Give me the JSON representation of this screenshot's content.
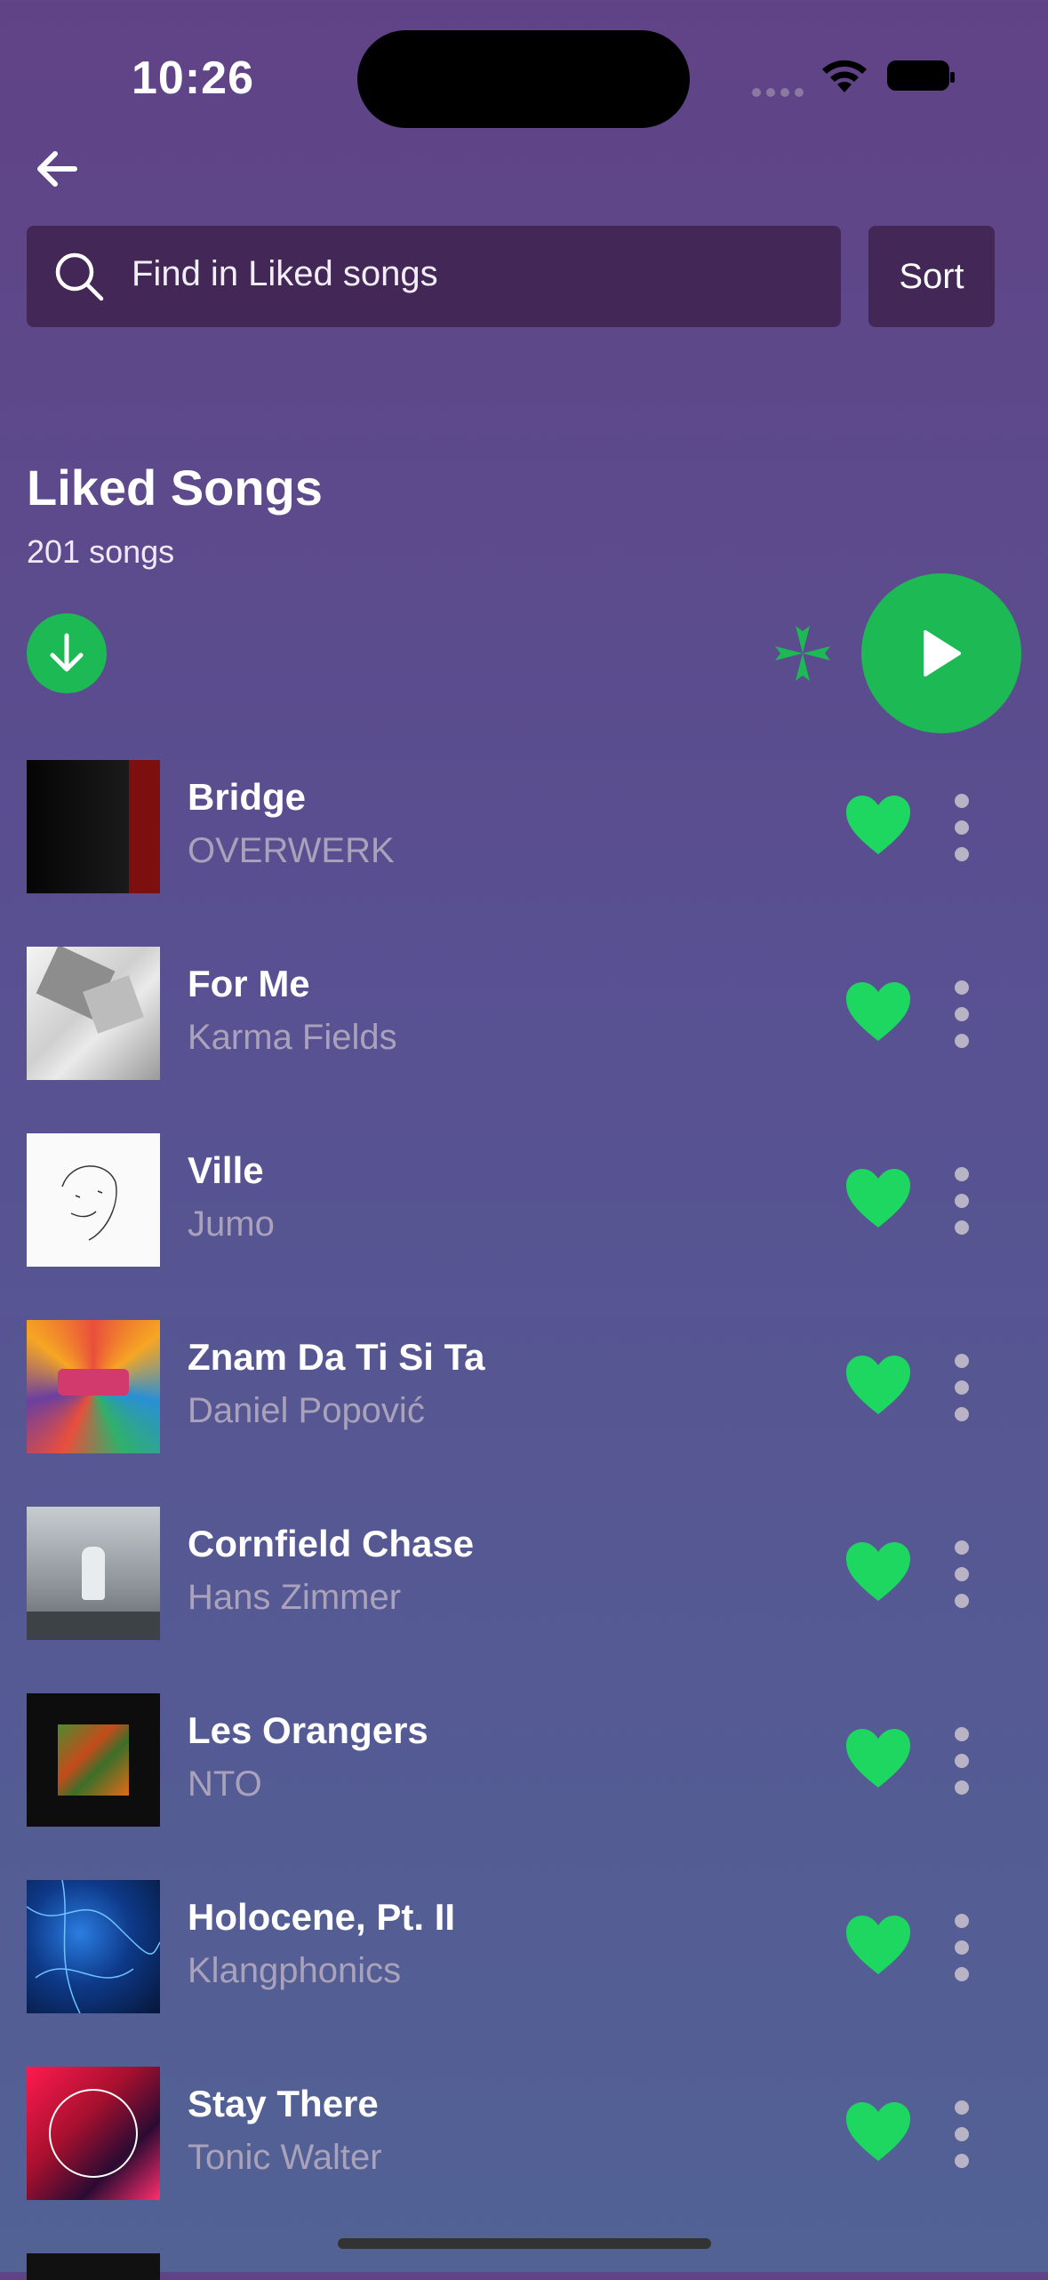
{
  "status_bar": {
    "time": "10:26"
  },
  "search": {
    "placeholder": "Find in Liked songs",
    "sort_label": "Sort"
  },
  "header": {
    "title": "Liked Songs",
    "count": "201 songs"
  },
  "colors": {
    "accent": "#1db954",
    "search_bg": "#432757",
    "subtext": "#a9a2ba"
  },
  "icons": [
    "back-arrow-icon",
    "search-icon",
    "download-icon",
    "shuffle-icon",
    "play-icon",
    "heart-icon",
    "more-vertical-icon"
  ],
  "songs": [
    {
      "title": "Bridge",
      "artist": "OVERWERK"
    },
    {
      "title": "For Me",
      "artist": "Karma Fields"
    },
    {
      "title": "Ville",
      "artist": "Jumo"
    },
    {
      "title": "Znam Da Ti Si Ta",
      "artist": "Daniel Popović"
    },
    {
      "title": "Cornfield Chase",
      "artist": "Hans Zimmer"
    },
    {
      "title": "Les Orangers",
      "artist": "NTO"
    },
    {
      "title": "Holocene, Pt. II",
      "artist": "Klangphonics"
    },
    {
      "title": "Stay There",
      "artist": "Tonic Walter"
    }
  ]
}
